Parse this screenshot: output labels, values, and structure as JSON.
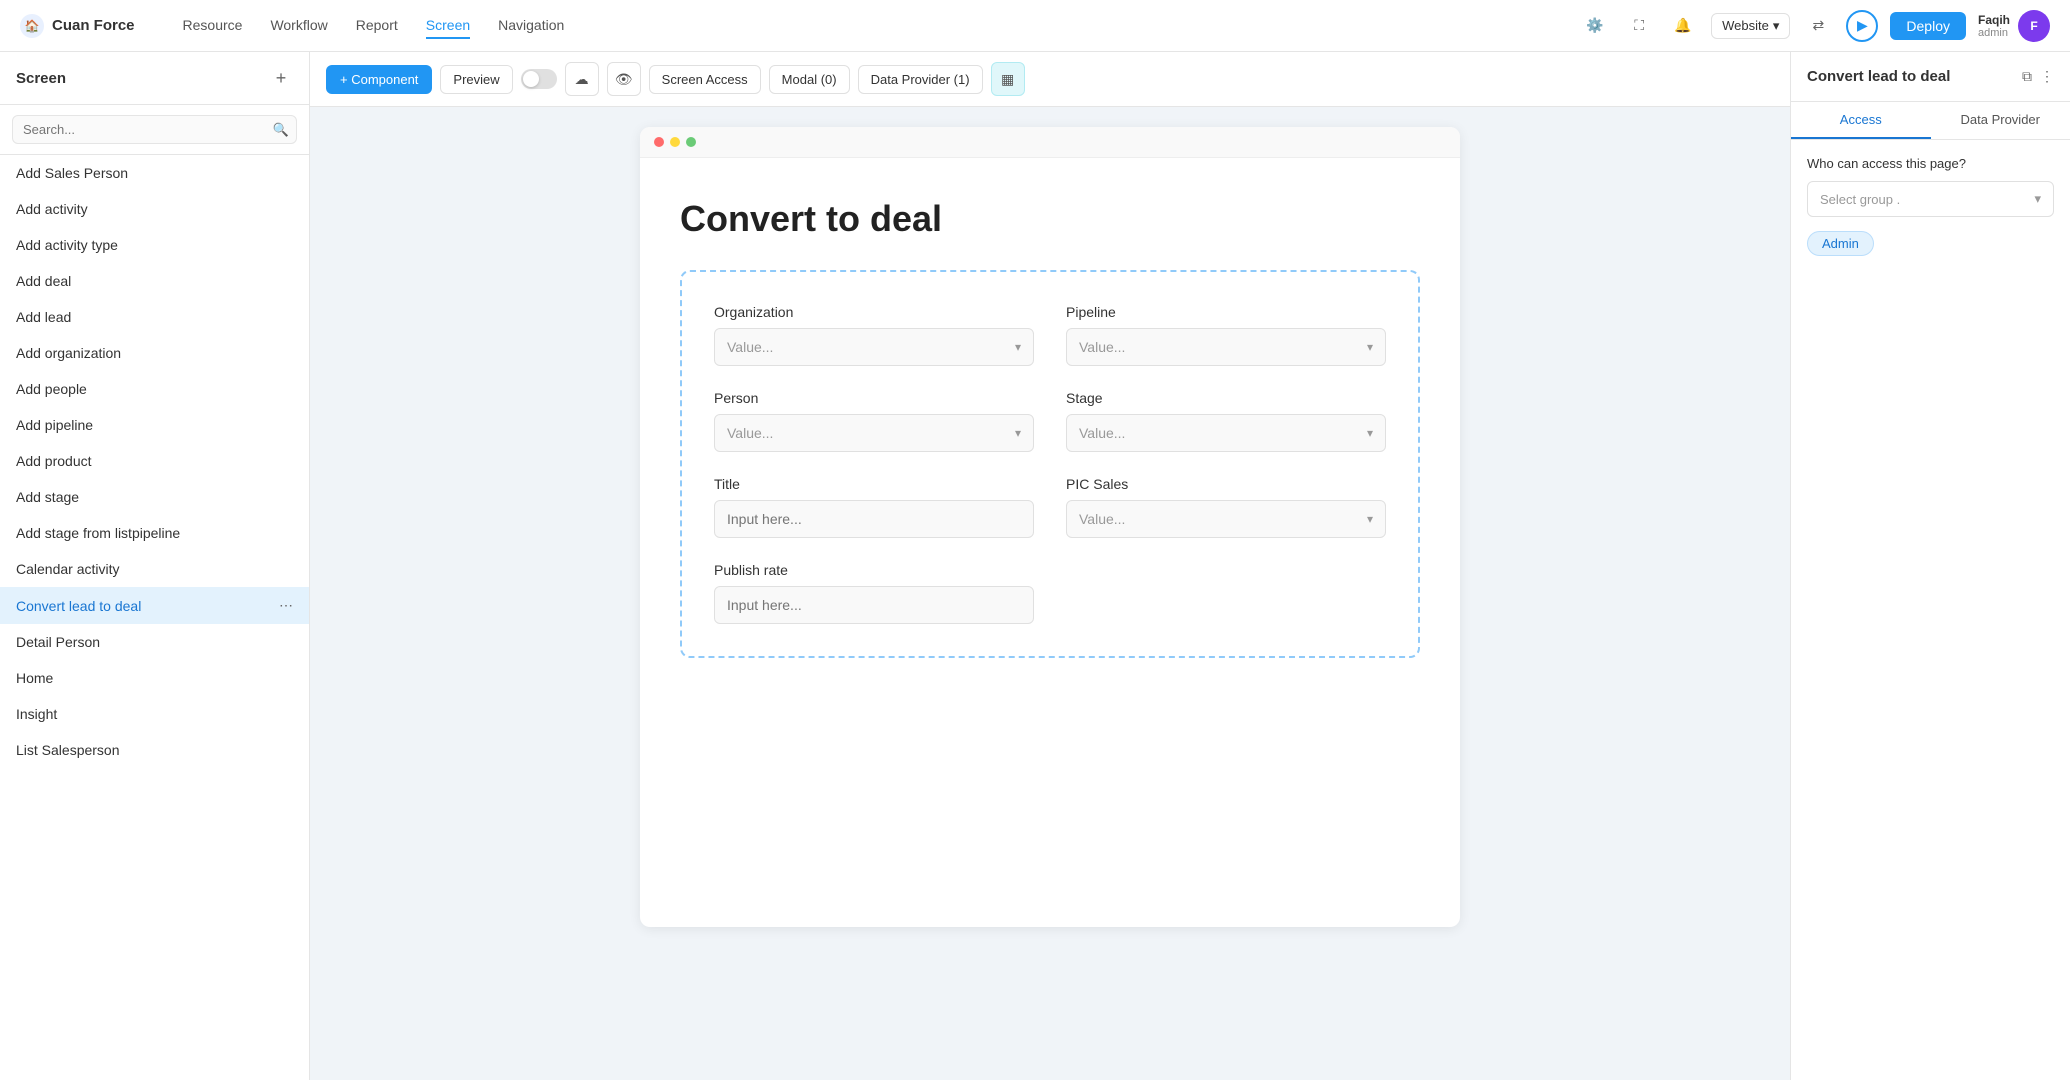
{
  "app": {
    "name": "Cuan Force"
  },
  "top_nav": {
    "links": [
      {
        "label": "Resource",
        "active": false
      },
      {
        "label": "Workflow",
        "active": false
      },
      {
        "label": "Report",
        "active": false
      },
      {
        "label": "Screen",
        "active": true
      },
      {
        "label": "Navigation",
        "active": false
      }
    ],
    "website_label": "Website",
    "deploy_label": "Deploy",
    "user_name": "Faqih",
    "user_role": "admin"
  },
  "toolbar": {
    "component_label": "+ Component",
    "preview_label": "Preview",
    "screen_access_label": "Screen Access",
    "modal_label": "Modal (0)",
    "data_provider_label": "Data Provider (1)"
  },
  "sidebar": {
    "title": "Screen",
    "search_placeholder": "Search...",
    "items": [
      {
        "label": "Add Sales Person",
        "active": false
      },
      {
        "label": "Add activity",
        "active": false
      },
      {
        "label": "Add activity type",
        "active": false
      },
      {
        "label": "Add deal",
        "active": false
      },
      {
        "label": "Add lead",
        "active": false
      },
      {
        "label": "Add organization",
        "active": false
      },
      {
        "label": "Add people",
        "active": false
      },
      {
        "label": "Add pipeline",
        "active": false
      },
      {
        "label": "Add product",
        "active": false
      },
      {
        "label": "Add stage",
        "active": false
      },
      {
        "label": "Add stage from listpipeline",
        "active": false
      },
      {
        "label": "Calendar activity",
        "active": false
      },
      {
        "label": "Convert lead to deal",
        "active": true
      },
      {
        "label": "Detail Person",
        "active": false
      },
      {
        "label": "Home",
        "active": false
      },
      {
        "label": "Insight",
        "active": false
      },
      {
        "label": "List Salesperson",
        "active": false
      }
    ]
  },
  "canvas": {
    "page_title": "Convert to deal",
    "form": {
      "fields": [
        {
          "label": "Organization",
          "type": "select",
          "placeholder": "Value...",
          "col": 0,
          "row": 0
        },
        {
          "label": "Pipeline",
          "type": "select",
          "placeholder": "Value...",
          "col": 1,
          "row": 0
        },
        {
          "label": "Person",
          "type": "select",
          "placeholder": "Value...",
          "col": 0,
          "row": 1
        },
        {
          "label": "Stage",
          "type": "select",
          "placeholder": "Value...",
          "col": 1,
          "row": 1
        },
        {
          "label": "Title",
          "type": "input",
          "placeholder": "Input here...",
          "col": 0,
          "row": 2
        },
        {
          "label": "PIC Sales",
          "type": "select",
          "placeholder": "Value...",
          "col": 1,
          "row": 2
        },
        {
          "label": "Publish rate",
          "type": "input",
          "placeholder": "Input here...",
          "col": 0,
          "row": 3
        }
      ]
    }
  },
  "right_panel": {
    "title": "Convert lead to deal",
    "tabs": [
      {
        "label": "Access",
        "active": true
      },
      {
        "label": "Data Provider",
        "active": false
      }
    ],
    "access": {
      "label": "Who can access this page?",
      "select_placeholder": "Select group .",
      "badge_label": "Admin"
    }
  }
}
